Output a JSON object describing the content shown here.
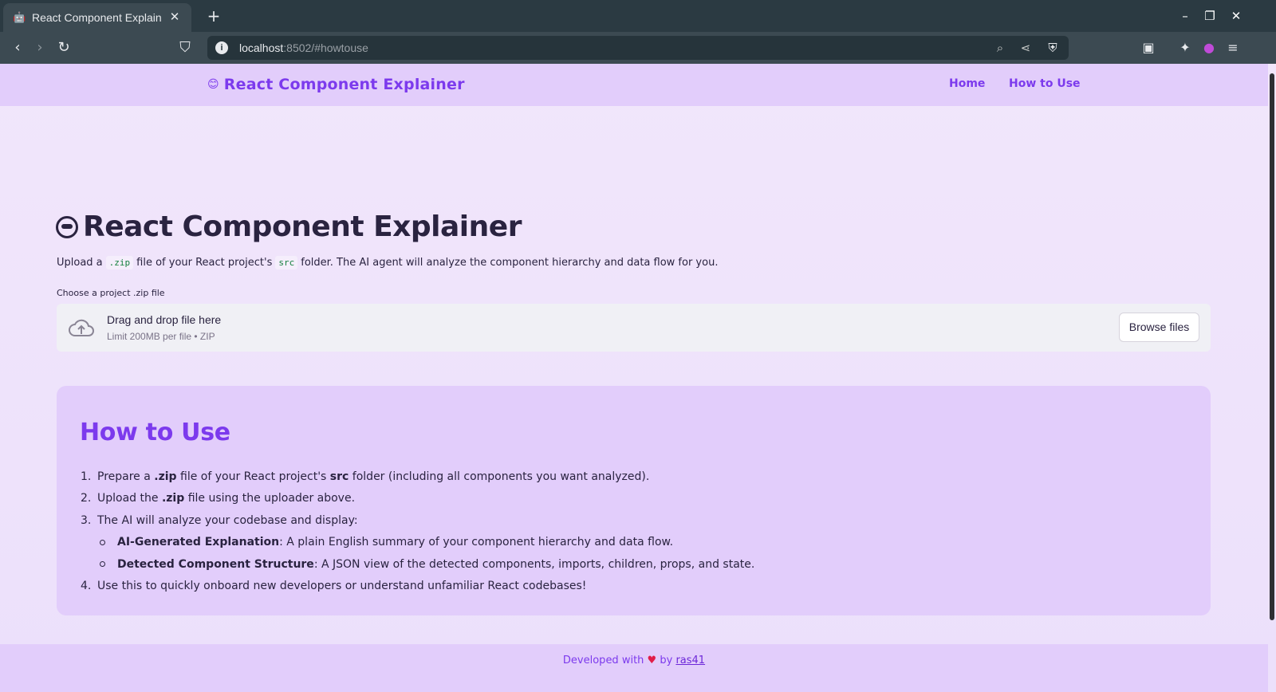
{
  "browser": {
    "tab_title": "React Component Explain",
    "tab_favicon": "🤖",
    "url_host": "localhost",
    "url_rest": ":8502/#howtouse"
  },
  "header": {
    "brand_icon": "😊",
    "brand": "React Component Explainer",
    "nav": [
      "Home",
      "How to Use"
    ]
  },
  "main": {
    "title": "React Component Explainer",
    "intro": {
      "part1": "Upload a",
      "code1": ".zip",
      "part2": "file of your React project's",
      "code2": "src",
      "part3": "folder. The AI agent will analyze the component hierarchy and data flow for you."
    },
    "upload": {
      "label": "Choose a project .zip file",
      "main_text": "Drag and drop file here",
      "sub_text": "Limit 200MB per file • ZIP",
      "button": "Browse files"
    }
  },
  "howto": {
    "title": "How to Use",
    "steps": [
      {
        "num": "1.",
        "a": "Prepare a ",
        "b1": ".zip",
        "c": " file of your React project's ",
        "b2": "src",
        "d": " folder (including all components you want analyzed)."
      },
      {
        "num": "2.",
        "a": "Upload the ",
        "b1": ".zip",
        "c": " file using the uploader above."
      },
      {
        "num": "3.",
        "a": "The AI will analyze your codebase and display:"
      },
      {
        "num": "4.",
        "a": "Use this to quickly onboard new developers or understand unfamiliar React codebases!"
      }
    ],
    "substeps": [
      {
        "bold": "AI-Generated Explanation",
        "rest": ": A plain English summary of your component hierarchy and data flow."
      },
      {
        "bold": "Detected Component Structure",
        "rest": ": A JSON view of the detected components, imports, children, props, and state."
      }
    ]
  },
  "footer": {
    "prefix": "Developed with",
    "heart": "♥",
    "by": "by",
    "author": "ras41"
  }
}
